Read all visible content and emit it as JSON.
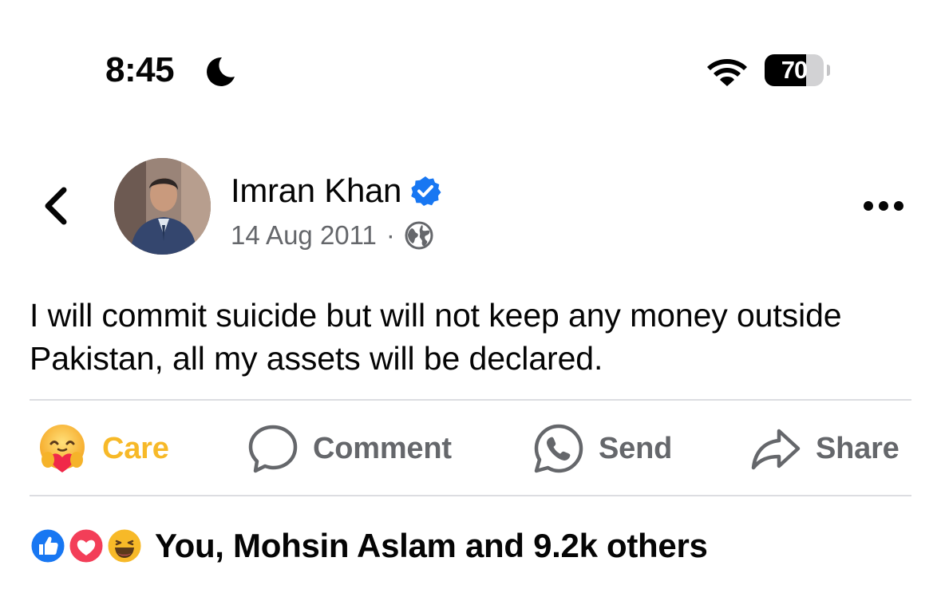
{
  "status_bar": {
    "time": "8:45",
    "battery_percent": 70,
    "battery_label": "70",
    "icons": [
      "moon-icon",
      "wifi-icon",
      "battery-icon"
    ]
  },
  "post": {
    "author": "Imran Khan",
    "verified": true,
    "date": "14 Aug 2011",
    "separator": "·",
    "audience_icon": "globe-icon",
    "text": "I will commit suicide but will not keep any money outside Pakistan, all my assets will be declared."
  },
  "actions": [
    {
      "label": "Care",
      "icon": "care-reaction-icon"
    },
    {
      "label": "Comment",
      "icon": "comment-icon"
    },
    {
      "label": "Send",
      "icon": "whatsapp-icon"
    },
    {
      "label": "Share",
      "icon": "share-icon"
    }
  ],
  "reactions": {
    "icons": [
      "like-icon",
      "love-icon",
      "haha-icon"
    ],
    "summary": "You, Mohsin Aslam and 9.2k others"
  },
  "colors": {
    "accent_blue": "#1877f2",
    "care_yellow": "#f7b928",
    "secondary_text": "#65676b",
    "divider": "#dcdde1"
  }
}
